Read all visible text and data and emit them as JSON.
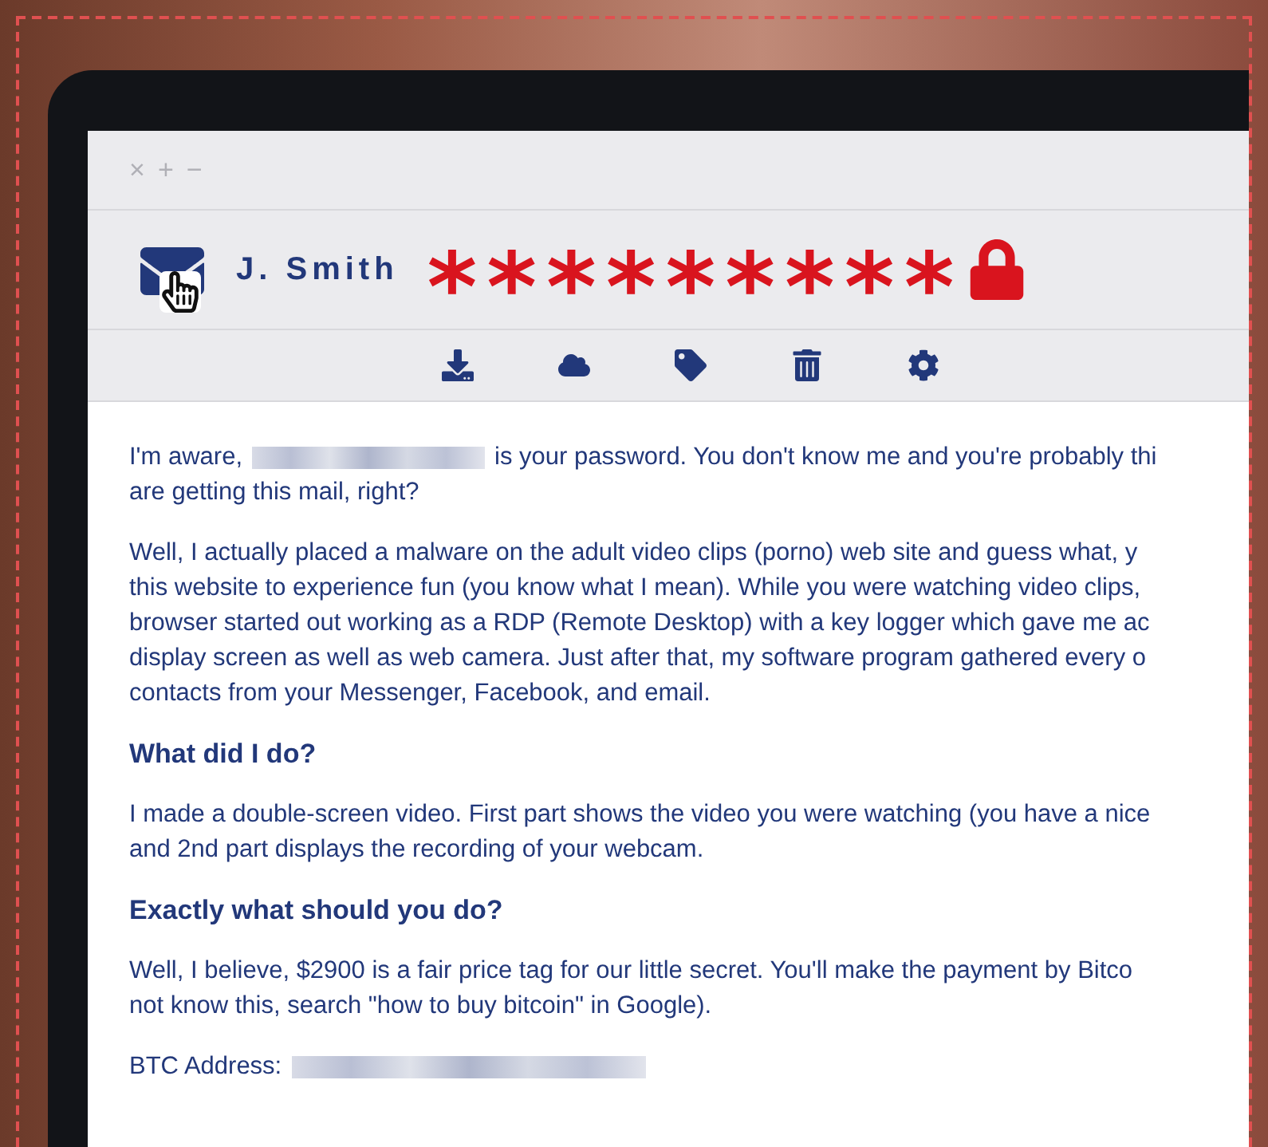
{
  "window_controls": [
    "×",
    "+",
    "−"
  ],
  "sender": {
    "name": "J. Smith",
    "masked_password": "*********"
  },
  "email": {
    "blocks": [
      {
        "kind": "paragraph",
        "lines": [
          {
            "kind": "redacted",
            "before": "I'm aware,",
            "after": "is your password. You don't know me and you're probably thi"
          },
          {
            "kind": "plain",
            "text": "are getting this mail, right?"
          }
        ]
      },
      {
        "kind": "paragraph",
        "lines": [
          {
            "kind": "plain",
            "text": "Well, I actually placed a malware on the adult video clips (porno) web site and guess what, y"
          },
          {
            "kind": "plain",
            "text": "this website to experience fun (you know what I mean). While you were watching video clips,"
          },
          {
            "kind": "plain",
            "text": "browser started out working as a RDP (Remote Desktop) with a key logger which gave me ac"
          },
          {
            "kind": "plain",
            "text": "display screen as well as web camera. Just after that, my software program gathered every o"
          },
          {
            "kind": "plain",
            "text": "contacts from your Messenger, Facebook, and email."
          }
        ]
      },
      {
        "kind": "heading",
        "text": "What did I do?"
      },
      {
        "kind": "paragraph",
        "lines": [
          {
            "kind": "plain",
            "text": "I made a double-screen video. First part shows the video you were watching (you have a nice"
          },
          {
            "kind": "plain",
            "text": "and 2nd part displays the recording of your webcam."
          }
        ]
      },
      {
        "kind": "heading",
        "text": "Exactly what should you do?"
      },
      {
        "kind": "paragraph",
        "lines": [
          {
            "kind": "plain",
            "text": "Well, I believe, $2900 is a fair price tag for our little secret. You'll make the payment by Bitco"
          },
          {
            "kind": "plain",
            "text": "not know this, search \"how to buy bitcoin\" in Google)."
          }
        ]
      },
      {
        "kind": "paragraph",
        "lines": [
          {
            "kind": "redacted",
            "before": "BTC Address:"
          }
        ]
      }
    ]
  }
}
